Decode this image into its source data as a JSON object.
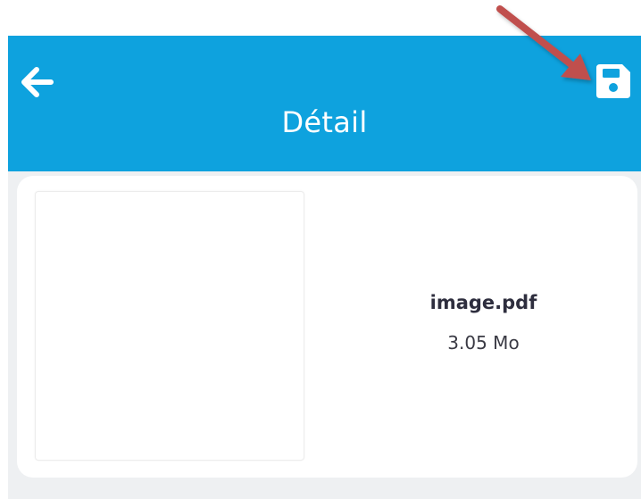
{
  "header": {
    "title": "Détail",
    "back_icon": "arrow-left-icon",
    "save_icon": "floppy-disk-icon"
  },
  "file": {
    "name": "image.pdf",
    "size": "3.05 Mo"
  },
  "colors": {
    "app_bar": "#0ea2de",
    "card": "#ffffff",
    "background": "#eef0f2",
    "annotation_arrow": "#c0504d"
  }
}
